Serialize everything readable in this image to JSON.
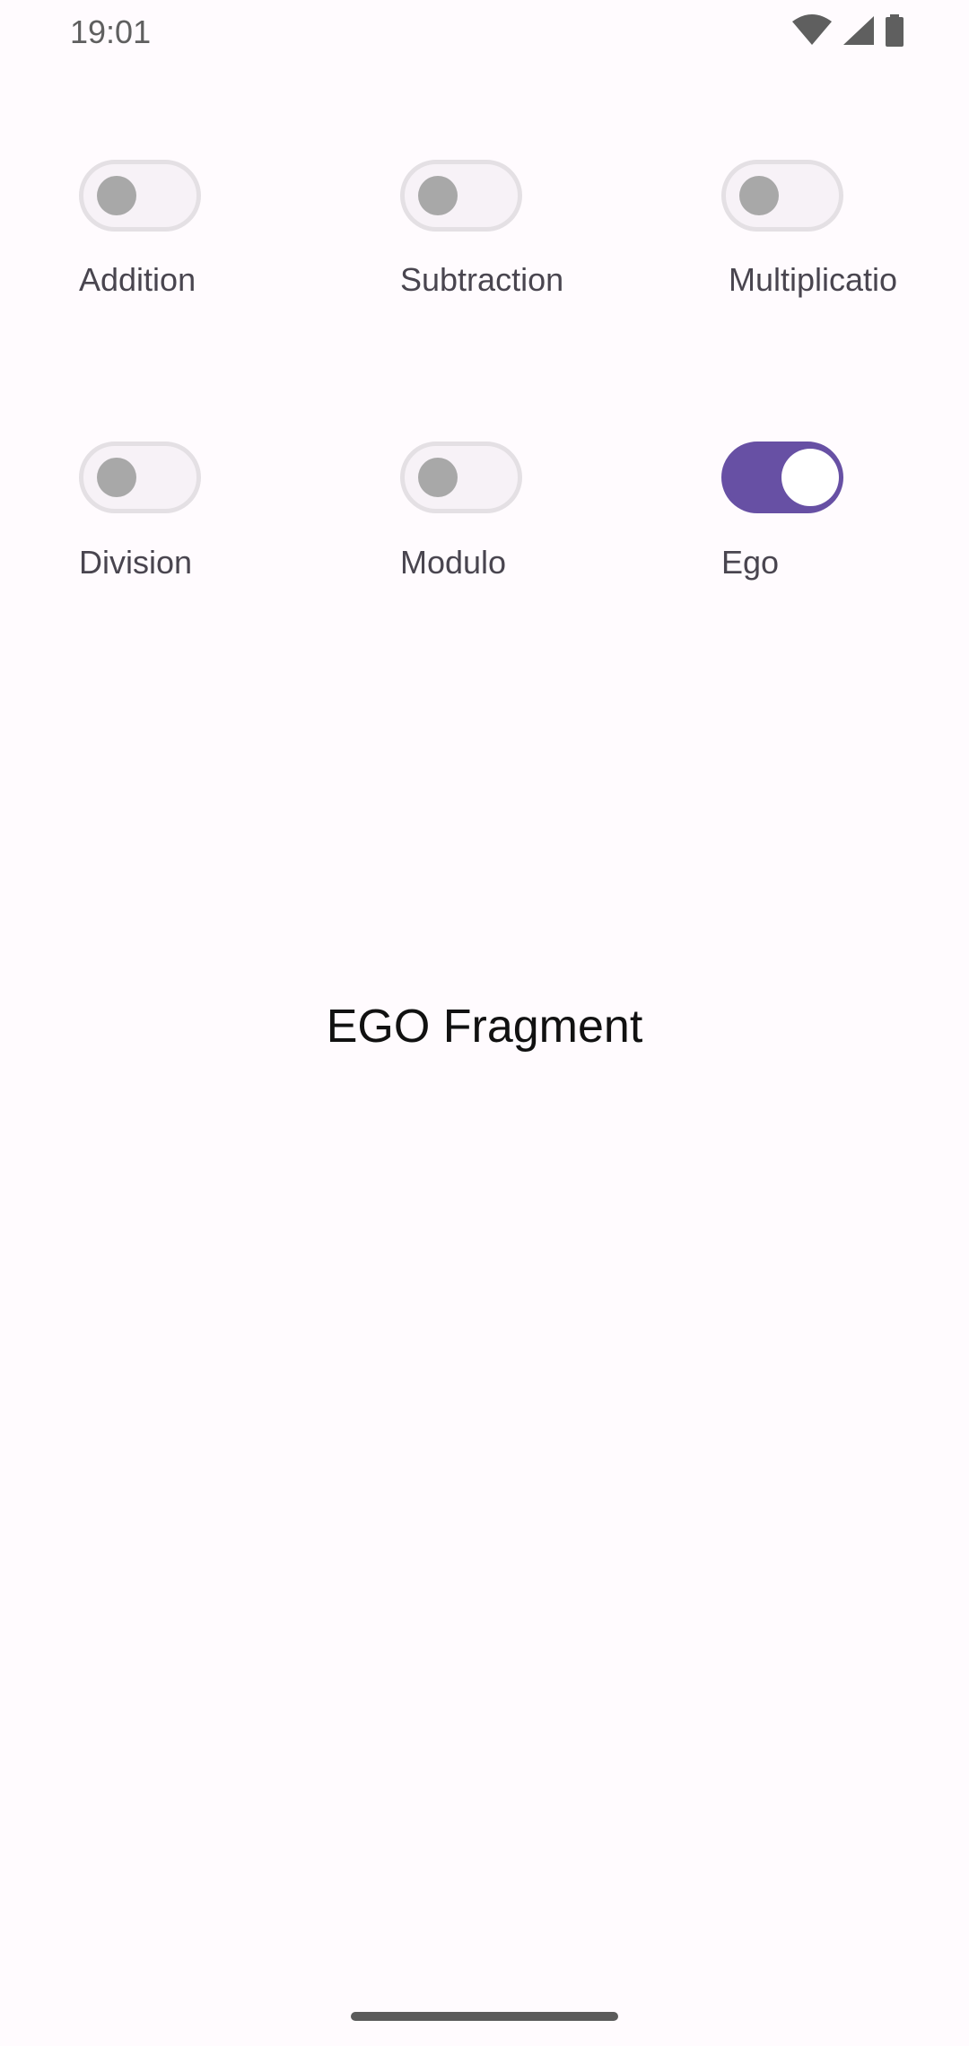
{
  "status_bar": {
    "time": "19:01",
    "icons": [
      "wifi-icon",
      "signal-icon",
      "battery-icon"
    ]
  },
  "toggles": [
    {
      "label": "Addition",
      "checked": false
    },
    {
      "label": "Subtraction",
      "checked": false
    },
    {
      "label": "Multiplicatio",
      "checked": false
    },
    {
      "label": "Division",
      "checked": false
    },
    {
      "label": "Modulo",
      "checked": false
    },
    {
      "label": "Ego",
      "checked": true
    }
  ],
  "fragment": {
    "text": "EGO Fragment"
  },
  "colors": {
    "accent": "#6750a4",
    "switch_off_track": "#f7f2f7",
    "switch_off_thumb": "#a8a8a8",
    "background": "#fffbfe"
  }
}
